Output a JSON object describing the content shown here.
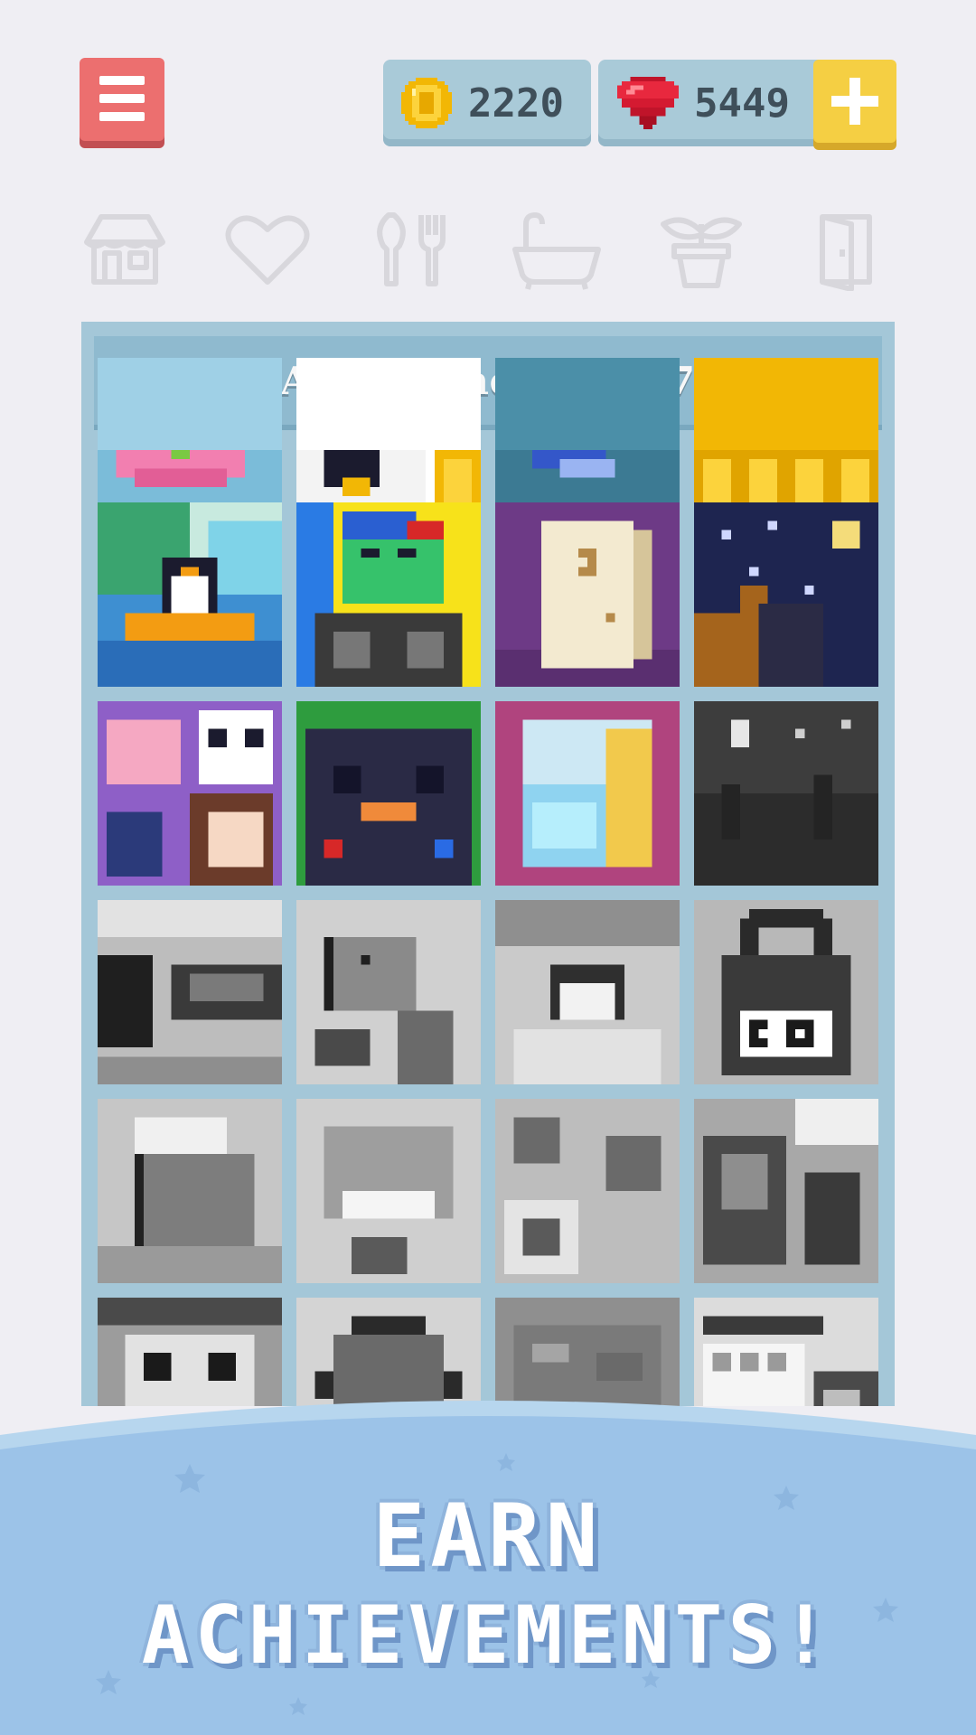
{
  "header": {
    "menu_label": "menu",
    "coins": "2220",
    "gems": "5449",
    "add_label": "+"
  },
  "categories": [
    {
      "name": "house-icon"
    },
    {
      "name": "heart-icon"
    },
    {
      "name": "food-icon"
    },
    {
      "name": "bathtub-icon"
    },
    {
      "name": "plant-icon"
    },
    {
      "name": "door-icon"
    }
  ],
  "achievements": {
    "title": "Achievement 27/57",
    "unlocked": 27,
    "total": 57
  },
  "banner": {
    "line1": "EARN",
    "line2": "ACHIEVEMENTS!"
  },
  "colors": {
    "background": "#efeef3",
    "panel": "#a4c7d8",
    "menu_button": "#ec6f6f",
    "plus_button": "#f5cf43",
    "banner": "#9cc3e8"
  }
}
